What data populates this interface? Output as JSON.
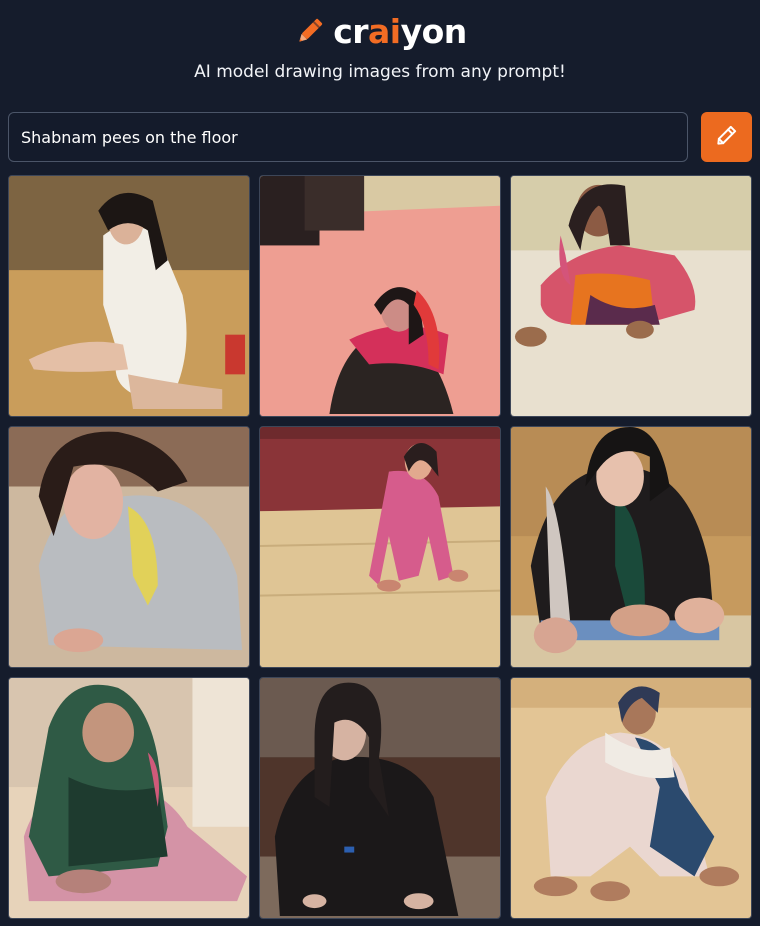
{
  "header": {
    "logo_parts": [
      "cr",
      "ai",
      "yon"
    ],
    "tagline": "AI model drawing images from any prompt!"
  },
  "prompt": {
    "value": "Shabnam pees on the floor",
    "draw_button_icon": "pencil-icon"
  },
  "colors": {
    "background": "#151c2c",
    "accent": "#ec6a1f",
    "input_border": "#4b5568"
  },
  "results": {
    "count": 9,
    "images": [
      {
        "alt": "generated-image-1"
      },
      {
        "alt": "generated-image-2"
      },
      {
        "alt": "generated-image-3"
      },
      {
        "alt": "generated-image-4"
      },
      {
        "alt": "generated-image-5"
      },
      {
        "alt": "generated-image-6"
      },
      {
        "alt": "generated-image-7"
      },
      {
        "alt": "generated-image-8"
      },
      {
        "alt": "generated-image-9"
      }
    ]
  }
}
